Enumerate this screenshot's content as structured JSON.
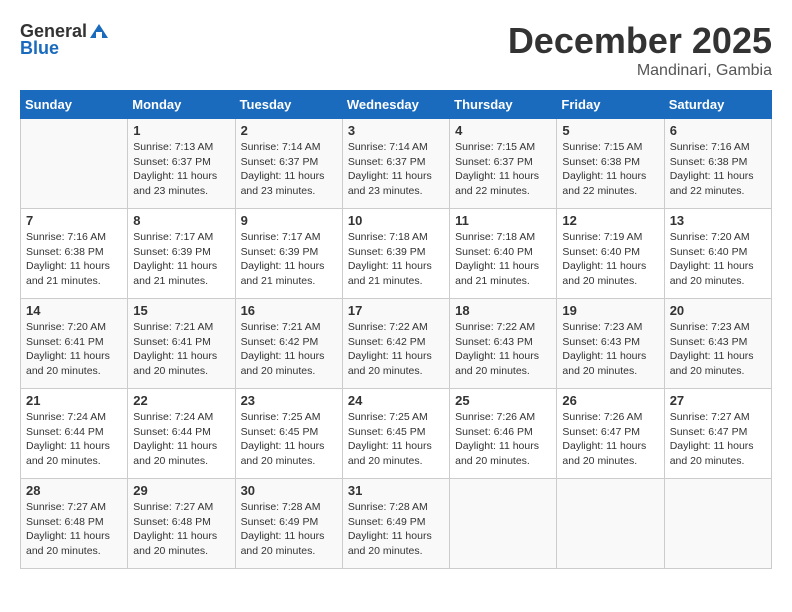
{
  "header": {
    "logo_general": "General",
    "logo_blue": "Blue",
    "month_title": "December 2025",
    "subtitle": "Mandinari, Gambia"
  },
  "calendar": {
    "days_of_week": [
      "Sunday",
      "Monday",
      "Tuesday",
      "Wednesday",
      "Thursday",
      "Friday",
      "Saturday"
    ],
    "weeks": [
      [
        {
          "day": "",
          "content": ""
        },
        {
          "day": "1",
          "content": "Sunrise: 7:13 AM\nSunset: 6:37 PM\nDaylight: 11 hours\nand 23 minutes."
        },
        {
          "day": "2",
          "content": "Sunrise: 7:14 AM\nSunset: 6:37 PM\nDaylight: 11 hours\nand 23 minutes."
        },
        {
          "day": "3",
          "content": "Sunrise: 7:14 AM\nSunset: 6:37 PM\nDaylight: 11 hours\nand 23 minutes."
        },
        {
          "day": "4",
          "content": "Sunrise: 7:15 AM\nSunset: 6:37 PM\nDaylight: 11 hours\nand 22 minutes."
        },
        {
          "day": "5",
          "content": "Sunrise: 7:15 AM\nSunset: 6:38 PM\nDaylight: 11 hours\nand 22 minutes."
        },
        {
          "day": "6",
          "content": "Sunrise: 7:16 AM\nSunset: 6:38 PM\nDaylight: 11 hours\nand 22 minutes."
        }
      ],
      [
        {
          "day": "7",
          "content": "Sunrise: 7:16 AM\nSunset: 6:38 PM\nDaylight: 11 hours\nand 21 minutes."
        },
        {
          "day": "8",
          "content": "Sunrise: 7:17 AM\nSunset: 6:39 PM\nDaylight: 11 hours\nand 21 minutes."
        },
        {
          "day": "9",
          "content": "Sunrise: 7:17 AM\nSunset: 6:39 PM\nDaylight: 11 hours\nand 21 minutes."
        },
        {
          "day": "10",
          "content": "Sunrise: 7:18 AM\nSunset: 6:39 PM\nDaylight: 11 hours\nand 21 minutes."
        },
        {
          "day": "11",
          "content": "Sunrise: 7:18 AM\nSunset: 6:40 PM\nDaylight: 11 hours\nand 21 minutes."
        },
        {
          "day": "12",
          "content": "Sunrise: 7:19 AM\nSunset: 6:40 PM\nDaylight: 11 hours\nand 20 minutes."
        },
        {
          "day": "13",
          "content": "Sunrise: 7:20 AM\nSunset: 6:40 PM\nDaylight: 11 hours\nand 20 minutes."
        }
      ],
      [
        {
          "day": "14",
          "content": "Sunrise: 7:20 AM\nSunset: 6:41 PM\nDaylight: 11 hours\nand 20 minutes."
        },
        {
          "day": "15",
          "content": "Sunrise: 7:21 AM\nSunset: 6:41 PM\nDaylight: 11 hours\nand 20 minutes."
        },
        {
          "day": "16",
          "content": "Sunrise: 7:21 AM\nSunset: 6:42 PM\nDaylight: 11 hours\nand 20 minutes."
        },
        {
          "day": "17",
          "content": "Sunrise: 7:22 AM\nSunset: 6:42 PM\nDaylight: 11 hours\nand 20 minutes."
        },
        {
          "day": "18",
          "content": "Sunrise: 7:22 AM\nSunset: 6:43 PM\nDaylight: 11 hours\nand 20 minutes."
        },
        {
          "day": "19",
          "content": "Sunrise: 7:23 AM\nSunset: 6:43 PM\nDaylight: 11 hours\nand 20 minutes."
        },
        {
          "day": "20",
          "content": "Sunrise: 7:23 AM\nSunset: 6:43 PM\nDaylight: 11 hours\nand 20 minutes."
        }
      ],
      [
        {
          "day": "21",
          "content": "Sunrise: 7:24 AM\nSunset: 6:44 PM\nDaylight: 11 hours\nand 20 minutes."
        },
        {
          "day": "22",
          "content": "Sunrise: 7:24 AM\nSunset: 6:44 PM\nDaylight: 11 hours\nand 20 minutes."
        },
        {
          "day": "23",
          "content": "Sunrise: 7:25 AM\nSunset: 6:45 PM\nDaylight: 11 hours\nand 20 minutes."
        },
        {
          "day": "24",
          "content": "Sunrise: 7:25 AM\nSunset: 6:45 PM\nDaylight: 11 hours\nand 20 minutes."
        },
        {
          "day": "25",
          "content": "Sunrise: 7:26 AM\nSunset: 6:46 PM\nDaylight: 11 hours\nand 20 minutes."
        },
        {
          "day": "26",
          "content": "Sunrise: 7:26 AM\nSunset: 6:47 PM\nDaylight: 11 hours\nand 20 minutes."
        },
        {
          "day": "27",
          "content": "Sunrise: 7:27 AM\nSunset: 6:47 PM\nDaylight: 11 hours\nand 20 minutes."
        }
      ],
      [
        {
          "day": "28",
          "content": "Sunrise: 7:27 AM\nSunset: 6:48 PM\nDaylight: 11 hours\nand 20 minutes."
        },
        {
          "day": "29",
          "content": "Sunrise: 7:27 AM\nSunset: 6:48 PM\nDaylight: 11 hours\nand 20 minutes."
        },
        {
          "day": "30",
          "content": "Sunrise: 7:28 AM\nSunset: 6:49 PM\nDaylight: 11 hours\nand 20 minutes."
        },
        {
          "day": "31",
          "content": "Sunrise: 7:28 AM\nSunset: 6:49 PM\nDaylight: 11 hours\nand 20 minutes."
        },
        {
          "day": "",
          "content": ""
        },
        {
          "day": "",
          "content": ""
        },
        {
          "day": "",
          "content": ""
        }
      ]
    ]
  }
}
